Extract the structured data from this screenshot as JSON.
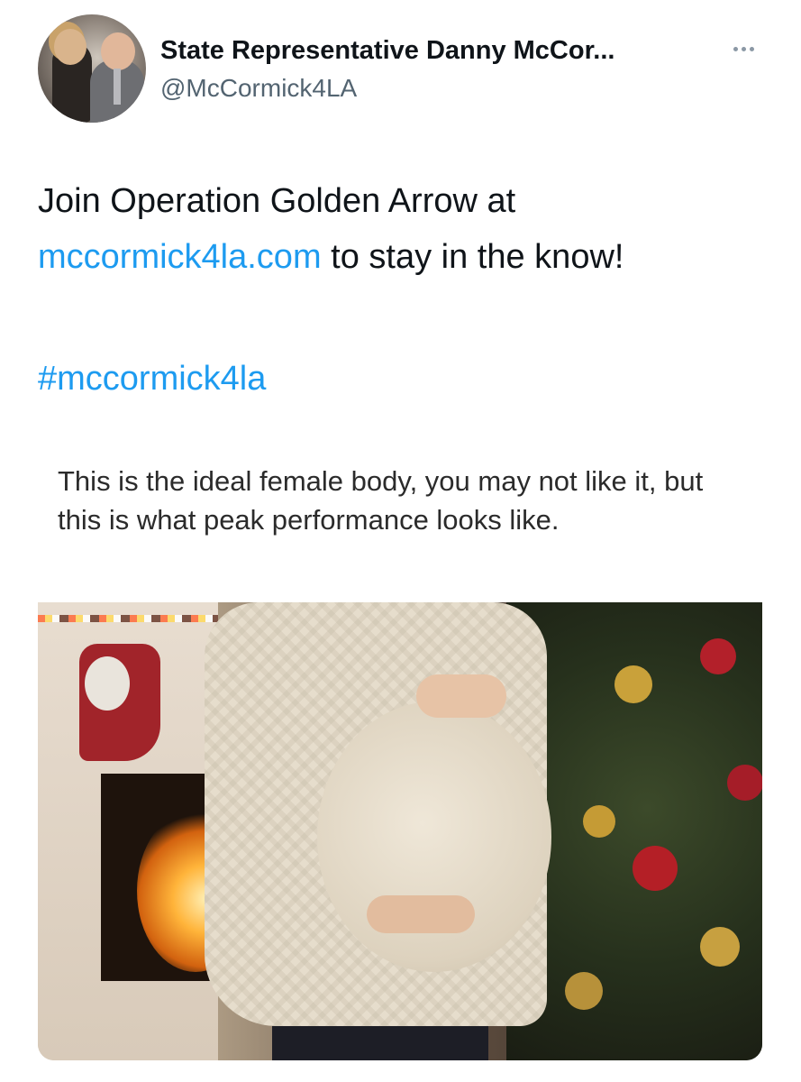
{
  "header": {
    "display_name": "State Representative Danny McCor...",
    "handle": "@McCormick4LA"
  },
  "tweet": {
    "text_before_link": "Join Operation Golden Arrow at ",
    "link": "mccormick4la.com",
    "text_after_link": " to stay in the know!",
    "hashtag": "#mccormick4la"
  },
  "media": {
    "caption": "This is the ideal female body, you may not like it, but this is what peak performance looks like."
  },
  "colors": {
    "link": "#1d9bf0",
    "handle": "#536471"
  }
}
